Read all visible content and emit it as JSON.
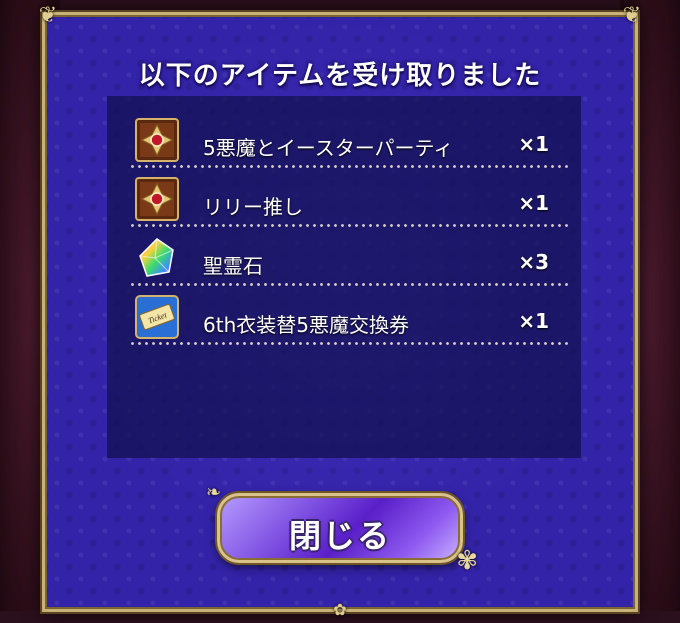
{
  "dialog": {
    "title": "以下のアイテムを受け取りました",
    "close_label": "閉じる"
  },
  "items": [
    {
      "name": "5悪魔とイースターパーティ",
      "qty": "×1",
      "icon": "card-medal-icon"
    },
    {
      "name": "リリー推し",
      "qty": "×1",
      "icon": "card-medal-icon"
    },
    {
      "name": "聖霊石",
      "qty": "×3",
      "icon": "rainbow-gem-icon"
    },
    {
      "name": "6th衣装替5悪魔交換券",
      "qty": "×1",
      "icon": "ticket-icon"
    }
  ],
  "colors": {
    "panel": "#3323a8",
    "gold": "#c9b27a",
    "button": "#7b4ce0"
  }
}
